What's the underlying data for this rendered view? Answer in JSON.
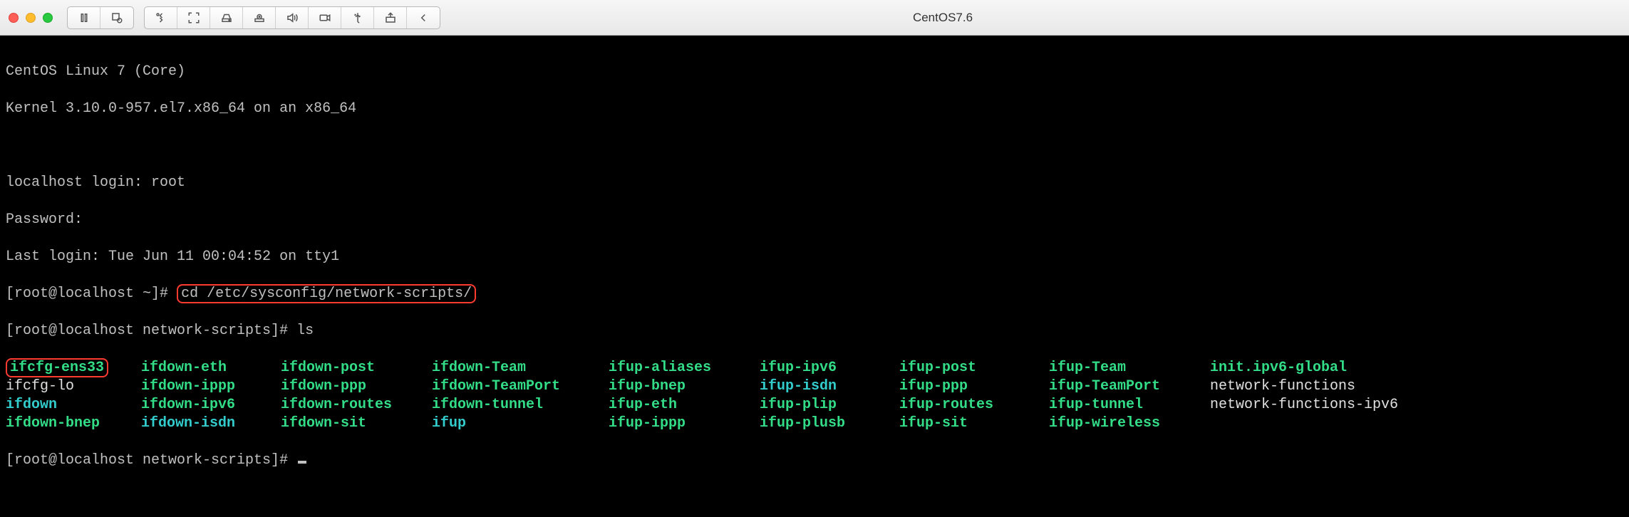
{
  "window": {
    "title": "CentOS7.6"
  },
  "terminal": {
    "line_os": "CentOS Linux 7 (Core)",
    "line_kernel": "Kernel 3.10.0-957.el7.x86_64 on an x86_64",
    "line_login": "localhost login: root",
    "line_password": "Password:",
    "line_lastlogin": "Last login: Tue Jun 11 00:04:52 on tty1",
    "prompt1_prefix": "[root@localhost ~]#",
    "cmd1": "cd /etc/sysconfig/network-scripts/",
    "prompt2_prefix": "[root@localhost network-scripts]#",
    "cmd2": "ls",
    "prompt3_prefix": "[root@localhost network-scripts]#",
    "files": [
      [
        "ifcfg-ens33",
        "ifdown-eth",
        "ifdown-post",
        "ifdown-Team",
        "ifup-aliases",
        "ifup-ipv6",
        "ifup-post",
        "ifup-Team",
        "init.ipv6-global"
      ],
      [
        "ifcfg-lo",
        "ifdown-ippp",
        "ifdown-ppp",
        "ifdown-TeamPort",
        "ifup-bnep",
        "ifup-isdn",
        "ifup-ppp",
        "ifup-TeamPort",
        "network-functions"
      ],
      [
        "ifdown",
        "ifdown-ipv6",
        "ifdown-routes",
        "ifdown-tunnel",
        "ifup-eth",
        "ifup-plip",
        "ifup-routes",
        "ifup-tunnel",
        "network-functions-ipv6"
      ],
      [
        "ifdown-bnep",
        "ifdown-isdn",
        "ifdown-sit",
        "ifup",
        "ifup-ippp",
        "ifup-plusb",
        "ifup-sit",
        "ifup-wireless",
        ""
      ]
    ],
    "colors": [
      [
        "green",
        "green",
        "green",
        "green",
        "green",
        "green",
        "green",
        "green",
        "green"
      ],
      [
        "white",
        "green",
        "green",
        "green",
        "green",
        "cyan",
        "green",
        "green",
        "white"
      ],
      [
        "cyan",
        "green",
        "green",
        "green",
        "green",
        "green",
        "green",
        "green",
        "white"
      ],
      [
        "green",
        "cyan",
        "green",
        "cyan",
        "green",
        "green",
        "green",
        "green",
        "white"
      ]
    ],
    "boxed": {
      "ifcfg-ens33": true
    }
  }
}
